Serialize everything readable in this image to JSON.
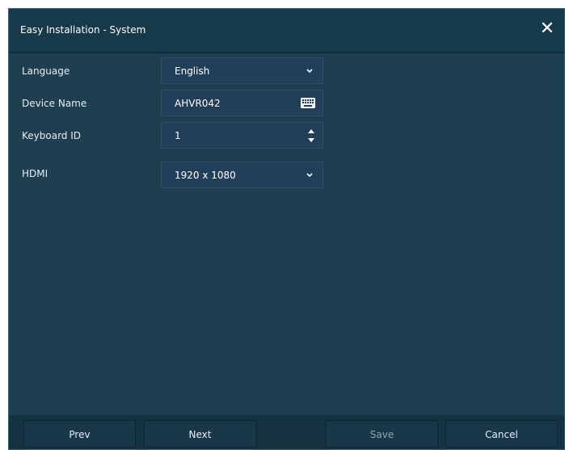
{
  "dialog": {
    "title": "Easy Installation - System",
    "close_label": "✕"
  },
  "fields": {
    "language": {
      "label": "Language",
      "value": "English"
    },
    "device_name": {
      "label": "Device Name",
      "value": "AHVR042"
    },
    "keyboard_id": {
      "label": "Keyboard ID",
      "value": "1"
    },
    "hdmi": {
      "label": "HDMI",
      "value": "1920 x 1080"
    }
  },
  "buttons": {
    "prev": "Prev",
    "next": "Next",
    "save": "Save",
    "cancel": "Cancel"
  }
}
